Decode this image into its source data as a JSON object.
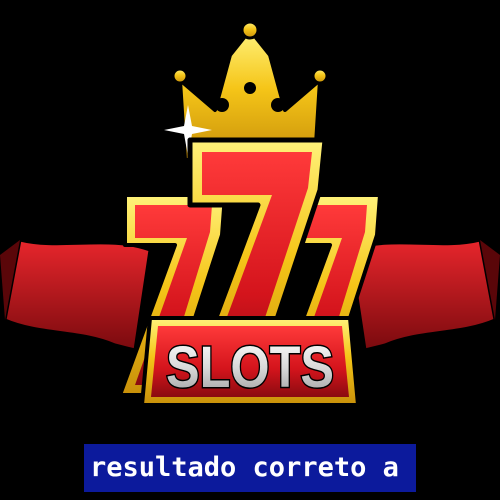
{
  "logo": {
    "text": "SLOTS",
    "digits": "777",
    "colors": {
      "gold": "#f5c518",
      "gold_dark": "#b8860b",
      "red": "#d4141c",
      "red_dark": "#7a0a0e",
      "silver": "#d9d9d9",
      "outline": "#000000"
    }
  },
  "caption": {
    "text": "resultado correto a",
    "background": "#0c1a9c"
  }
}
